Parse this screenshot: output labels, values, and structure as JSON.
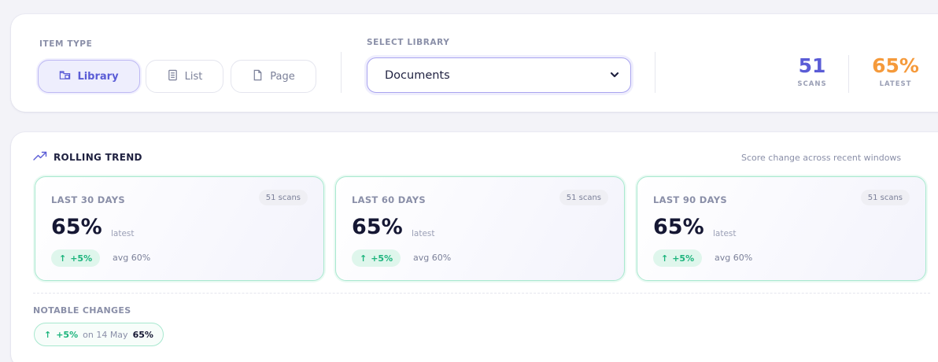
{
  "filters": {
    "item_type_label": "ITEM TYPE",
    "item_types": [
      {
        "label": "Library",
        "icon": "library-icon",
        "active": true
      },
      {
        "label": "List",
        "icon": "list-icon",
        "active": false
      },
      {
        "label": "Page",
        "icon": "page-icon",
        "active": false
      }
    ],
    "select_library_label": "SELECT LIBRARY",
    "selected_library": "Documents"
  },
  "summary": {
    "scans_value": "51",
    "scans_label": "SCANS",
    "scans_color": "#5a5cd6",
    "latest_value": "65%",
    "latest_label": "LATEST",
    "latest_color": "#f59a3b"
  },
  "trend": {
    "title": "ROLLING TREND",
    "title_icon": "trending-up-icon",
    "subtitle": "Score change across recent windows",
    "windows": [
      {
        "label": "LAST 30 DAYS",
        "scans": "51 scans",
        "score": "65%",
        "latest": "latest",
        "delta": "+5%",
        "avg": "avg 60%"
      },
      {
        "label": "LAST 60 DAYS",
        "scans": "51 scans",
        "score": "65%",
        "latest": "latest",
        "delta": "+5%",
        "avg": "avg 60%"
      },
      {
        "label": "LAST 90 DAYS",
        "scans": "51 scans",
        "score": "65%",
        "latest": "latest",
        "delta": "+5%",
        "avg": "avg 60%"
      }
    ],
    "notable_label": "NOTABLE CHANGES",
    "notable_changes": [
      {
        "delta": "+5%",
        "date": "on 14 May",
        "score": "65%"
      }
    ]
  },
  "colors": {
    "accent": "#5a5cd6",
    "positive": "#1bb47c",
    "warning": "#f59a3b"
  }
}
